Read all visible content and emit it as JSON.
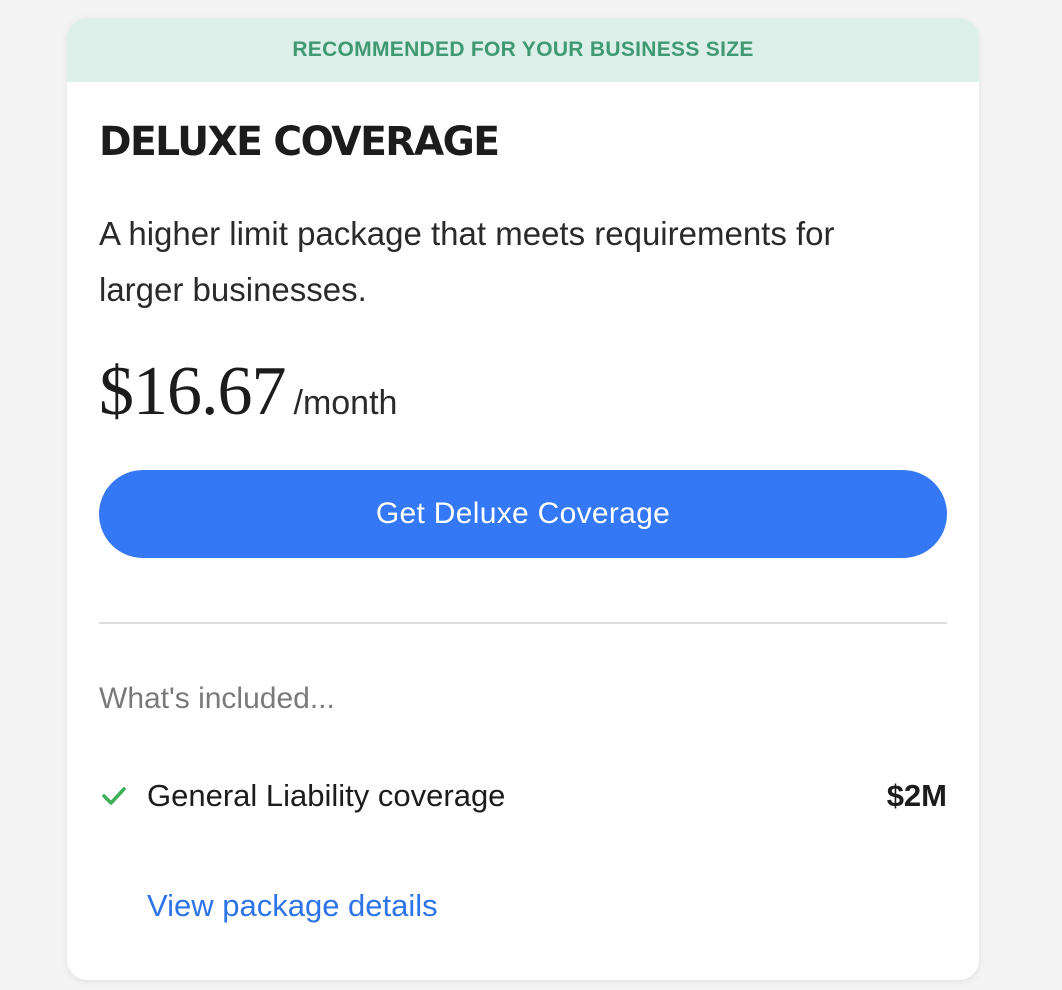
{
  "card": {
    "banner": "RECOMMENDED FOR YOUR BUSINESS SIZE",
    "title": "DELUXE COVERAGE",
    "description": "A higher limit package that meets requirements for larger businesses.",
    "price": "$16.67",
    "period": "/month",
    "cta_label": "Get Deluxe Coverage",
    "included_heading": "What's included...",
    "included_items": [
      {
        "icon": "check-icon",
        "label": "General Liability coverage",
        "value": "$2M"
      }
    ],
    "details_link": "View package details"
  },
  "colors": {
    "banner_bg": "#dcefe8",
    "banner_text": "#3f9a73",
    "cta_bg": "#3478f6",
    "link": "#2c74e8",
    "check": "#3fae5a"
  }
}
